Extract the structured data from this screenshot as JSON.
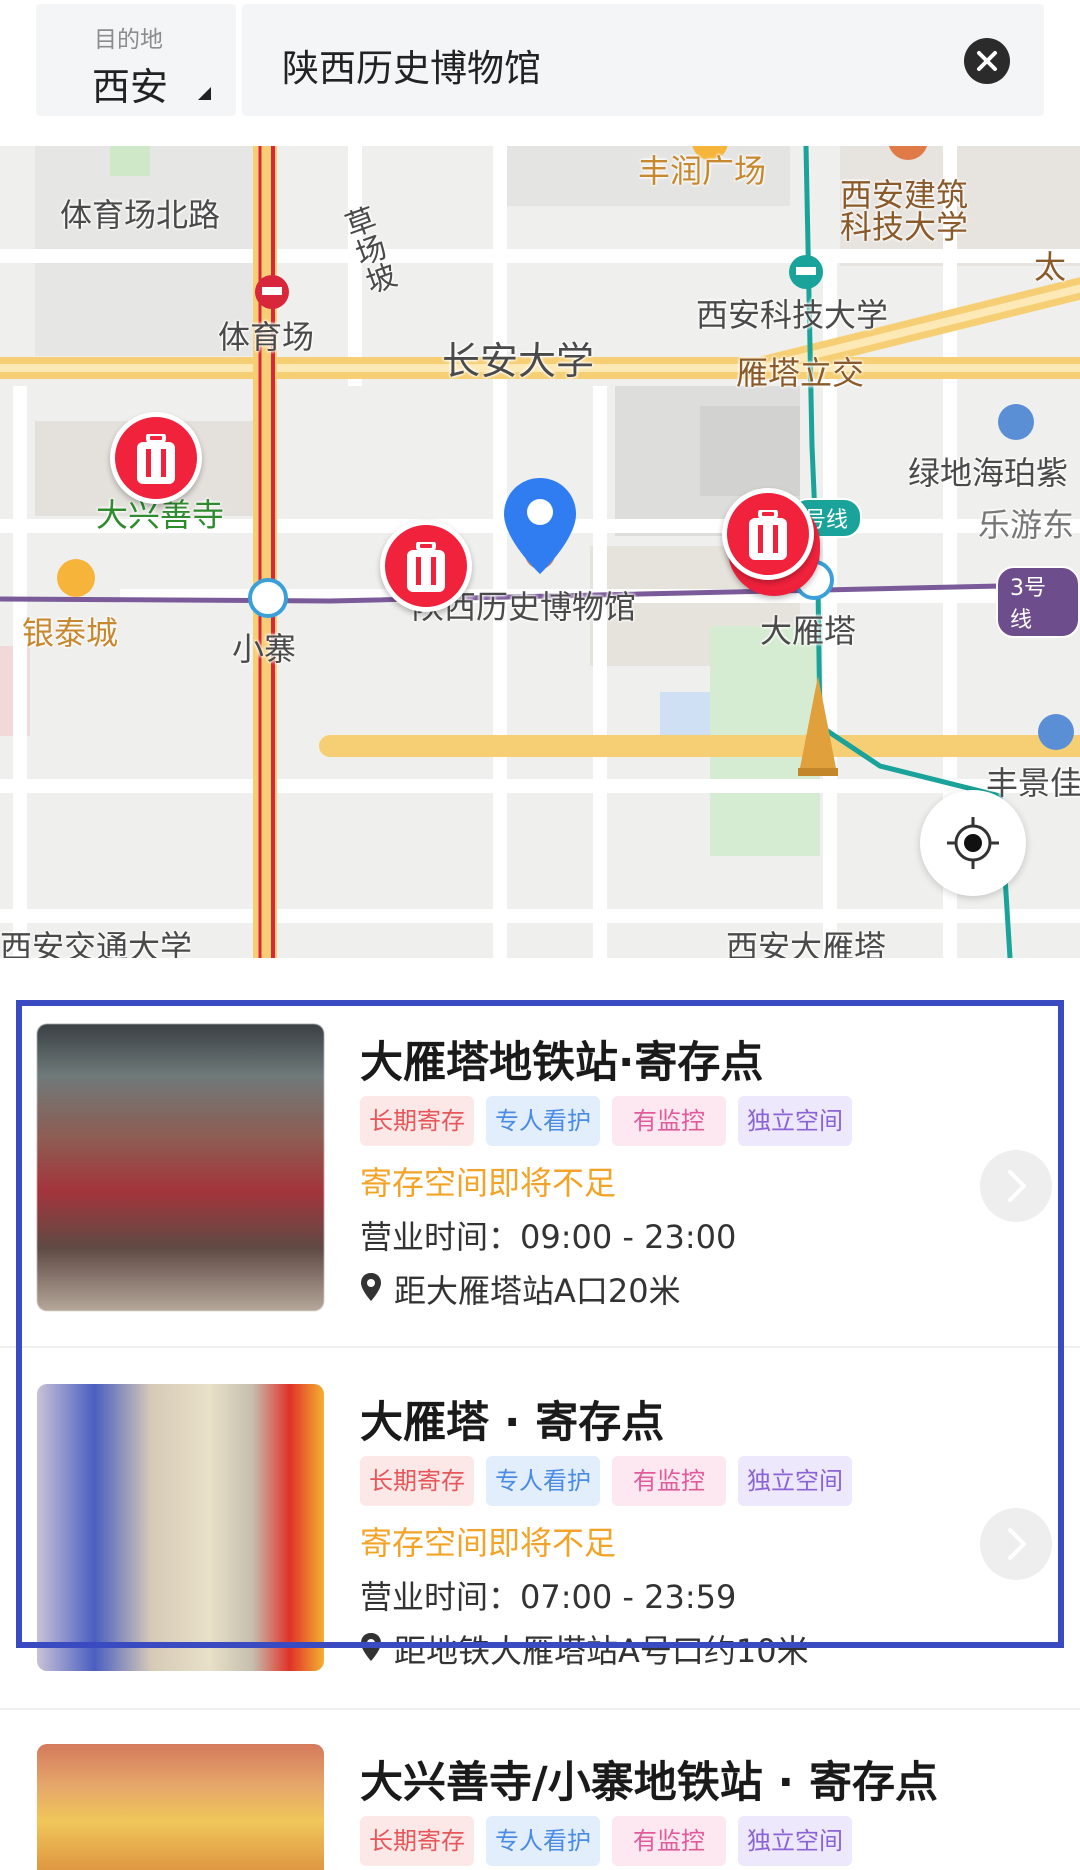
{
  "header": {
    "dest_label": "目的地",
    "city": "西安",
    "search_value": "陕西历史博物馆"
  },
  "map": {
    "labels": {
      "tiyuchang_beilu": "体育场北路",
      "caochangpo": "草场坡",
      "tiyuchang": "体育场",
      "changan_daxue": "长安大学",
      "fengrun": "丰润广场",
      "jianzhu": "西安建筑",
      "keji": "科技大学",
      "xian_keji_daxue": "西安科技大学",
      "tai": "太",
      "yanta_lijiao": "雁塔立交",
      "lvdi": "绿地海珀紫",
      "leyou": "乐游东",
      "daxingshan": "大兴善寺",
      "museum": "陕西历史博物馆",
      "yintai": "银泰城",
      "xiaozhai": "小寨",
      "dayanta": "大雁塔",
      "xianjiaoda": "西安交通大学",
      "xian_dayanta": "西安大雁塔",
      "fengjing": "丰景佳"
    },
    "line3": "3号线",
    "line4": "号线"
  },
  "cards": [
    {
      "title": "大雁塔地铁站·寄存点",
      "tags": [
        "长期寄存",
        "专人看护",
        "有监控",
        "独立空间"
      ],
      "warning": "寄存空间即将不足",
      "hours": "营业时间：09:00 - 23:00",
      "distance": "距大雁塔站A口20米"
    },
    {
      "title": "大雁塔 · 寄存点",
      "tags": [
        "长期寄存",
        "专人看护",
        "有监控",
        "独立空间"
      ],
      "warning": "寄存空间即将不足",
      "hours": "营业时间：07:00 - 23:59",
      "distance": "距地铁大雁塔站A号口约10米"
    },
    {
      "title": "大兴善寺/小寨地铁站 · 寄存点",
      "tags": [
        "长期寄存",
        "专人看护",
        "有监控",
        "独立空间"
      ]
    }
  ],
  "colors": {
    "accent_highlight": "#3a4bc2",
    "marker_red": "#f0223c",
    "pin_blue": "#2f7df0",
    "warning_orange": "#f3a428"
  }
}
